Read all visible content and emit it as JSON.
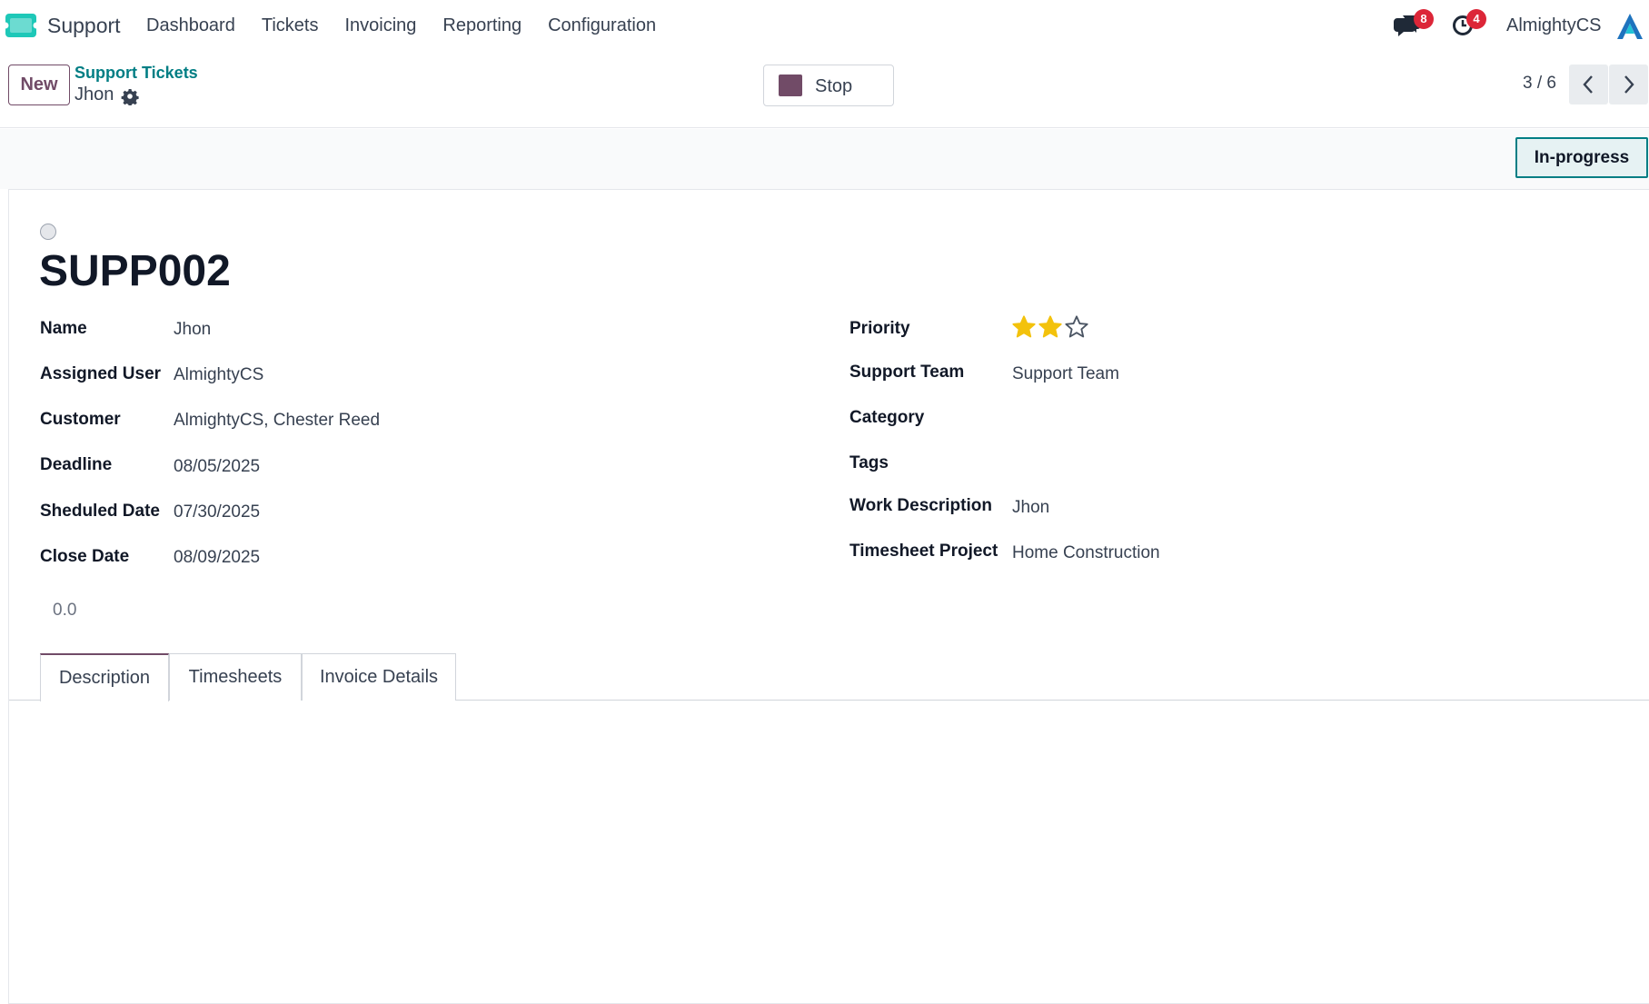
{
  "navbar": {
    "app_name": "Support",
    "menu": [
      "Dashboard",
      "Tickets",
      "Invoicing",
      "Reporting",
      "Configuration"
    ],
    "messages_badge": "8",
    "activities_badge": "4",
    "user": "AlmightyCS",
    "brand_color": "#1ec8b8"
  },
  "control": {
    "new_label": "New",
    "breadcrumb": "Support Tickets",
    "record_name": "Jhon",
    "stop_label": "Stop",
    "pager": "3 / 6"
  },
  "status": {
    "label": "In-progress"
  },
  "form": {
    "reference": "SUPP002",
    "left": [
      {
        "label": "Name",
        "value": "Jhon"
      },
      {
        "label": "Assigned User",
        "value": "AlmightyCS"
      },
      {
        "label": "Customer",
        "value": "AlmightyCS, Chester Reed"
      },
      {
        "label": "Deadline",
        "value": "08/05/2025"
      },
      {
        "label": "Sheduled Date",
        "value": "07/30/2025"
      },
      {
        "label": "Close Date",
        "value": "08/09/2025"
      }
    ],
    "right": [
      {
        "label": "Priority",
        "value": ""
      },
      {
        "label": "Support Team",
        "value": "Support Team"
      },
      {
        "label": "Category",
        "value": ""
      },
      {
        "label": "Tags",
        "value": ""
      },
      {
        "label": "Work Description",
        "value": "Jhon"
      },
      {
        "label": "Timesheet Project",
        "value": "Home Construction"
      }
    ],
    "priority": {
      "stars_filled": 2,
      "stars_total": 3,
      "star_color": "#f3c20c"
    },
    "hours": "0.0",
    "tabs": [
      "Description",
      "Timesheets",
      "Invoice Details"
    ],
    "active_tab": "Description"
  }
}
